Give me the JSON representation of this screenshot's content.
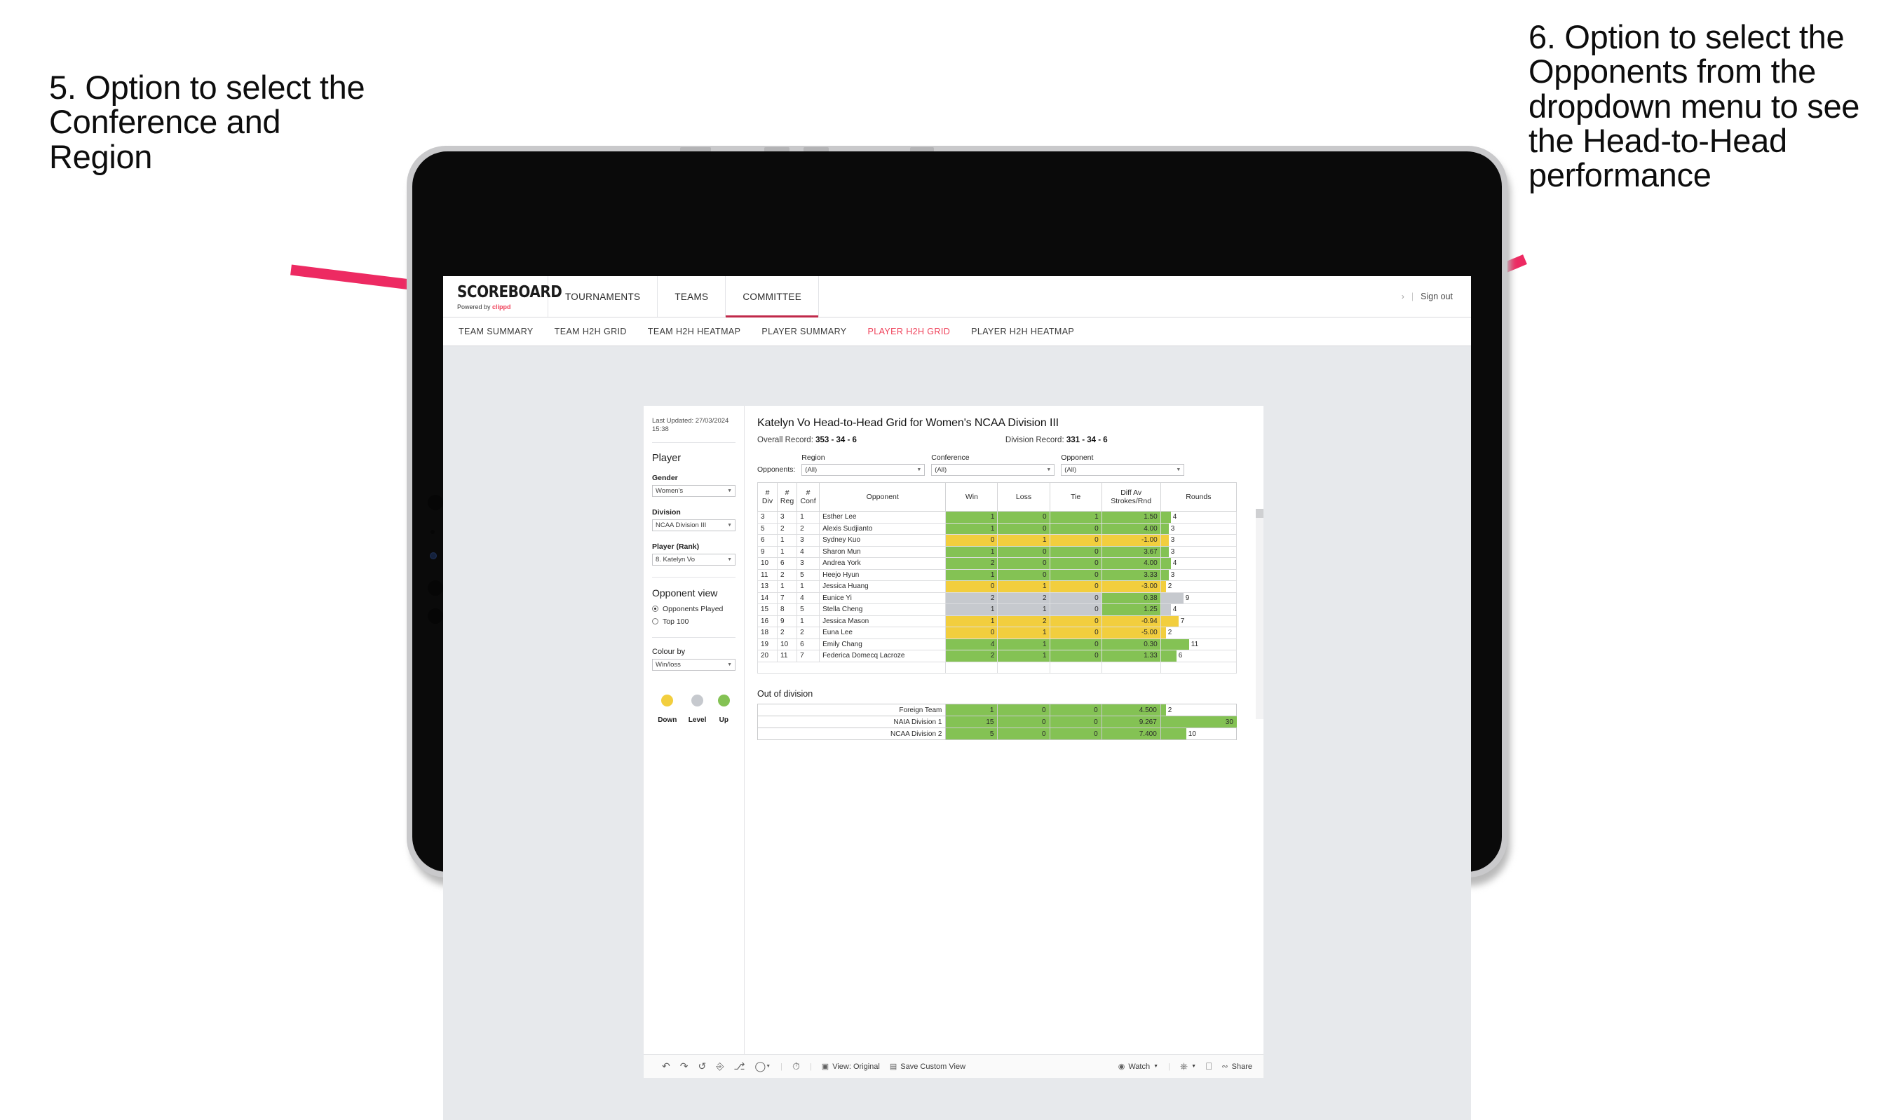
{
  "annotations": {
    "left": "5. Option to select the Conference and Region",
    "right": "6. Option to select the Opponents from the dropdown menu to see the Head-to-Head performance",
    "arrow_color": "#ED2A62"
  },
  "topnav": {
    "brand": "SCOREBOARD",
    "brand_sub_prefix": "Powered by ",
    "brand_sub_accent": "clippd",
    "items": [
      {
        "label": "TOURNAMENTS",
        "active": false
      },
      {
        "label": "TEAMS",
        "active": false
      },
      {
        "label": "COMMITTEE",
        "active": true
      }
    ],
    "sign_out": "Sign out",
    "separator": "|"
  },
  "subnav": {
    "items": [
      {
        "label": "TEAM SUMMARY",
        "selected": false
      },
      {
        "label": "TEAM H2H GRID",
        "selected": false
      },
      {
        "label": "TEAM H2H HEATMAP",
        "selected": false
      },
      {
        "label": "PLAYER SUMMARY",
        "selected": false
      },
      {
        "label": "PLAYER H2H GRID",
        "selected": true
      },
      {
        "label": "PLAYER H2H HEATMAP",
        "selected": false
      }
    ]
  },
  "sidebar": {
    "last_updated": "Last Updated: 27/03/2024 15:38",
    "player_heading": "Player",
    "gender_label": "Gender",
    "gender_value": "Women's",
    "division_label": "Division",
    "division_value": "NCAA Division III",
    "player_rank_label": "Player (Rank)",
    "player_rank_value": "8. Katelyn Vo",
    "opponent_view_heading": "Opponent view",
    "opponent_view_options": [
      {
        "label": "Opponents Played",
        "selected": true
      },
      {
        "label": "Top 100",
        "selected": false
      }
    ],
    "colour_by_label": "Colour by",
    "colour_by_value": "Win/loss",
    "legend": [
      {
        "label": "Down",
        "color": "#F2CE3E"
      },
      {
        "label": "Level",
        "color": "#C6C9CE"
      },
      {
        "label": "Up",
        "color": "#84C254"
      }
    ]
  },
  "main": {
    "title": "Katelyn Vo Head-to-Head Grid for Women's NCAA Division III",
    "overall_record_label": "Overall Record:",
    "overall_record_value": "353 - 34 - 6",
    "division_record_label": "Division Record:",
    "division_record_value": "331 - 34 - 6",
    "opponents_label": "Opponents:",
    "filters": [
      {
        "label": "Region",
        "value": "(All)"
      },
      {
        "label": "Conference",
        "value": "(All)"
      },
      {
        "label": "Opponent",
        "value": "(All)"
      }
    ]
  },
  "chart_data": {
    "type": "table",
    "title": "Katelyn Vo Head-to-Head Grid for Women's NCAA Division III",
    "columns": [
      "# Div",
      "# Reg",
      "# Conf",
      "Opponent",
      "Win",
      "Loss",
      "Tie",
      "Diff Av Strokes/Rnd",
      "Rounds"
    ],
    "column_header_lines": [
      [
        "#",
        "Div"
      ],
      [
        "#",
        "Reg"
      ],
      [
        "#",
        "Conf"
      ],
      [
        "Opponent"
      ],
      [
        "Win"
      ],
      [
        "Loss"
      ],
      [
        "Tie"
      ],
      [
        "Diff Av",
        "Strokes/Rnd"
      ],
      [
        "Rounds"
      ]
    ],
    "rounds_max": 30,
    "rows": [
      {
        "div": "3",
        "reg": "3",
        "conf": "1",
        "opponent": "Esther Lee",
        "win": "1",
        "loss": "0",
        "tie": "1",
        "diff": "1.50",
        "rounds": 4,
        "color": "#84C254"
      },
      {
        "div": "5",
        "reg": "2",
        "conf": "2",
        "opponent": "Alexis Sudjianto",
        "win": "1",
        "loss": "0",
        "tie": "0",
        "diff": "4.00",
        "rounds": 3,
        "color": "#84C254"
      },
      {
        "div": "6",
        "reg": "1",
        "conf": "3",
        "opponent": "Sydney Kuo",
        "win": "0",
        "loss": "1",
        "tie": "0",
        "diff": "-1.00",
        "rounds": 3,
        "color": "#F2CE3E"
      },
      {
        "div": "9",
        "reg": "1",
        "conf": "4",
        "opponent": "Sharon Mun",
        "win": "1",
        "loss": "0",
        "tie": "0",
        "diff": "3.67",
        "rounds": 3,
        "color": "#84C254"
      },
      {
        "div": "10",
        "reg": "6",
        "conf": "3",
        "opponent": "Andrea York",
        "win": "2",
        "loss": "0",
        "tie": "0",
        "diff": "4.00",
        "rounds": 4,
        "color": "#84C254"
      },
      {
        "div": "11",
        "reg": "2",
        "conf": "5",
        "opponent": "Heejo Hyun",
        "win": "1",
        "loss": "0",
        "tie": "0",
        "diff": "3.33",
        "rounds": 3,
        "color": "#84C254"
      },
      {
        "div": "13",
        "reg": "1",
        "conf": "1",
        "opponent": "Jessica Huang",
        "win": "0",
        "loss": "1",
        "tie": "0",
        "diff": "-3.00",
        "rounds": 2,
        "color": "#F2CE3E"
      },
      {
        "div": "14",
        "reg": "7",
        "conf": "4",
        "opponent": "Eunice Yi",
        "win": "2",
        "loss": "2",
        "tie": "0",
        "diff": "0.38",
        "rounds": 9,
        "color": "#C6C9CE",
        "diff_color": "#84C254"
      },
      {
        "div": "15",
        "reg": "8",
        "conf": "5",
        "opponent": "Stella Cheng",
        "win": "1",
        "loss": "1",
        "tie": "0",
        "diff": "1.25",
        "rounds": 4,
        "color": "#C6C9CE",
        "diff_color": "#84C254"
      },
      {
        "div": "16",
        "reg": "9",
        "conf": "1",
        "opponent": "Jessica Mason",
        "win": "1",
        "loss": "2",
        "tie": "0",
        "diff": "-0.94",
        "rounds": 7,
        "color": "#F2CE3E"
      },
      {
        "div": "18",
        "reg": "2",
        "conf": "2",
        "opponent": "Euna Lee",
        "win": "0",
        "loss": "1",
        "tie": "0",
        "diff": "-5.00",
        "rounds": 2,
        "color": "#F2CE3E"
      },
      {
        "div": "19",
        "reg": "10",
        "conf": "6",
        "opponent": "Emily Chang",
        "win": "4",
        "loss": "1",
        "tie": "0",
        "diff": "0.30",
        "rounds": 11,
        "color": "#84C254"
      },
      {
        "div": "20",
        "reg": "11",
        "conf": "7",
        "opponent": "Federica Domecq Lacroze",
        "win": "2",
        "loss": "1",
        "tie": "0",
        "diff": "1.33",
        "rounds": 6,
        "color": "#84C254"
      }
    ],
    "out_of_division_heading": "Out of division",
    "out_of_division_rows": [
      {
        "label": "Foreign Team",
        "win": "1",
        "loss": "0",
        "tie": "0",
        "diff": "4.500",
        "rounds": 2,
        "color": "#84C254"
      },
      {
        "label": "NAIA Division 1",
        "win": "15",
        "loss": "0",
        "tie": "0",
        "diff": "9.267",
        "rounds": 30,
        "color": "#84C254"
      },
      {
        "label": "NCAA Division 2",
        "win": "5",
        "loss": "0",
        "tie": "0",
        "diff": "7.400",
        "rounds": 10,
        "color": "#84C254"
      }
    ]
  },
  "toolbar": {
    "view_label": "View: Original",
    "save_label": "Save Custom View",
    "watch_label": "Watch",
    "share_label": "Share"
  }
}
